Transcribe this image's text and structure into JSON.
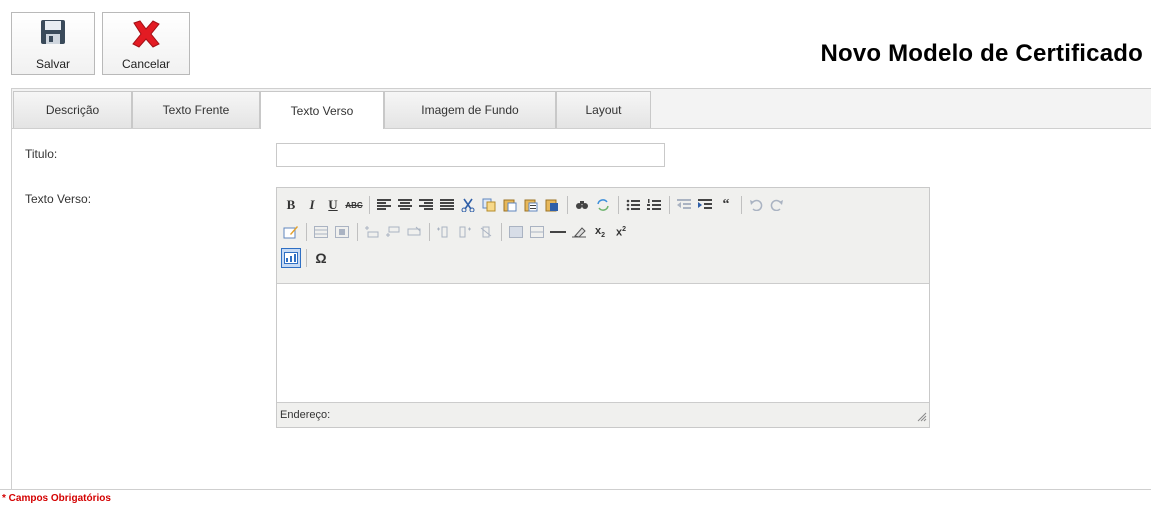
{
  "toolbar": {
    "save_label": "Salvar",
    "cancel_label": "Cancelar"
  },
  "page": {
    "title": "Novo Modelo de Certificado"
  },
  "tabs": [
    {
      "label": "Descrição",
      "active": false
    },
    {
      "label": "Texto Frente",
      "active": false
    },
    {
      "label": "Texto Verso",
      "active": true
    },
    {
      "label": "Imagem de Fundo",
      "active": false
    },
    {
      "label": "Layout",
      "active": false
    }
  ],
  "form": {
    "titulo_label": "Titulo:",
    "titulo_value": "",
    "texto_label": "Texto Verso:"
  },
  "editor": {
    "status_path_label": "Endereço:",
    "content": "",
    "toolbar_row1": [
      "bold-icon",
      "italic-icon",
      "underline-icon",
      "strikethrough-icon",
      "align-left-icon",
      "align-center-icon",
      "align-right-icon",
      "align-justify-icon",
      "cut-icon",
      "copy-icon",
      "paste-icon",
      "paste-text-icon",
      "paste-word-icon",
      "find-icon",
      "replace-icon",
      "bullet-list-icon",
      "numbered-list-icon",
      "outdent-icon",
      "indent-icon",
      "blockquote-icon",
      "undo-icon",
      "redo-icon"
    ],
    "toolbar_row2": [
      "edit-icon",
      "table-icon",
      "table-props-icon",
      "insert-row-before-icon",
      "insert-row-after-icon",
      "delete-row-icon",
      "insert-col-before-icon",
      "insert-col-after-icon",
      "delete-col-icon",
      "split-cells-icon",
      "merge-cells-icon",
      "horizontal-rule-icon",
      "remove-format-icon",
      "subscript-icon",
      "superscript-icon"
    ],
    "toolbar_row3": [
      "html-source-icon",
      "special-char-icon"
    ],
    "special_char_glyph": "Ω"
  },
  "footer": {
    "required_note": "* Campos Obrigatórios"
  },
  "colors": {
    "required": "#d40000",
    "cancel_icon": "#e31b23",
    "save_icon": "#3a4a5a"
  }
}
